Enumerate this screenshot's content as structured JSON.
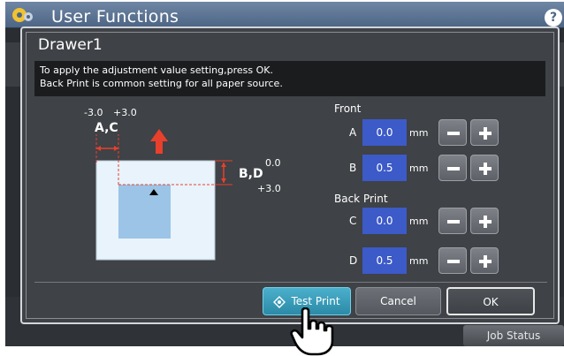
{
  "app": {
    "title": "User Functions",
    "help_label": "?"
  },
  "dialog": {
    "title": "Drawer1",
    "message_line1": "To apply the adjustment value setting,press OK.",
    "message_line2": "Back Print is common setting for all paper source."
  },
  "diagram": {
    "neg_label": "-3.0",
    "pos_label": "+3.0",
    "ac_label": "A,C",
    "bd_label": "B,D",
    "bd_top": "0.0",
    "bd_bottom": "+3.0"
  },
  "front": {
    "heading": "Front",
    "rows": [
      {
        "label": "A",
        "value": "0.0",
        "unit": "mm"
      },
      {
        "label": "B",
        "value": "0.5",
        "unit": "mm"
      }
    ]
  },
  "back": {
    "heading": "Back Print",
    "rows": [
      {
        "label": "C",
        "value": "0.0",
        "unit": "mm"
      },
      {
        "label": "D",
        "value": "0.5",
        "unit": "mm"
      }
    ]
  },
  "buttons": {
    "test_print": "Test Print",
    "cancel": "Cancel",
    "ok": "OK"
  },
  "status": {
    "job_status": "Job Status"
  },
  "colors": {
    "accent": "#3c5ac8",
    "test_print": "#2b8aa7",
    "arrow": "#e8402c"
  }
}
